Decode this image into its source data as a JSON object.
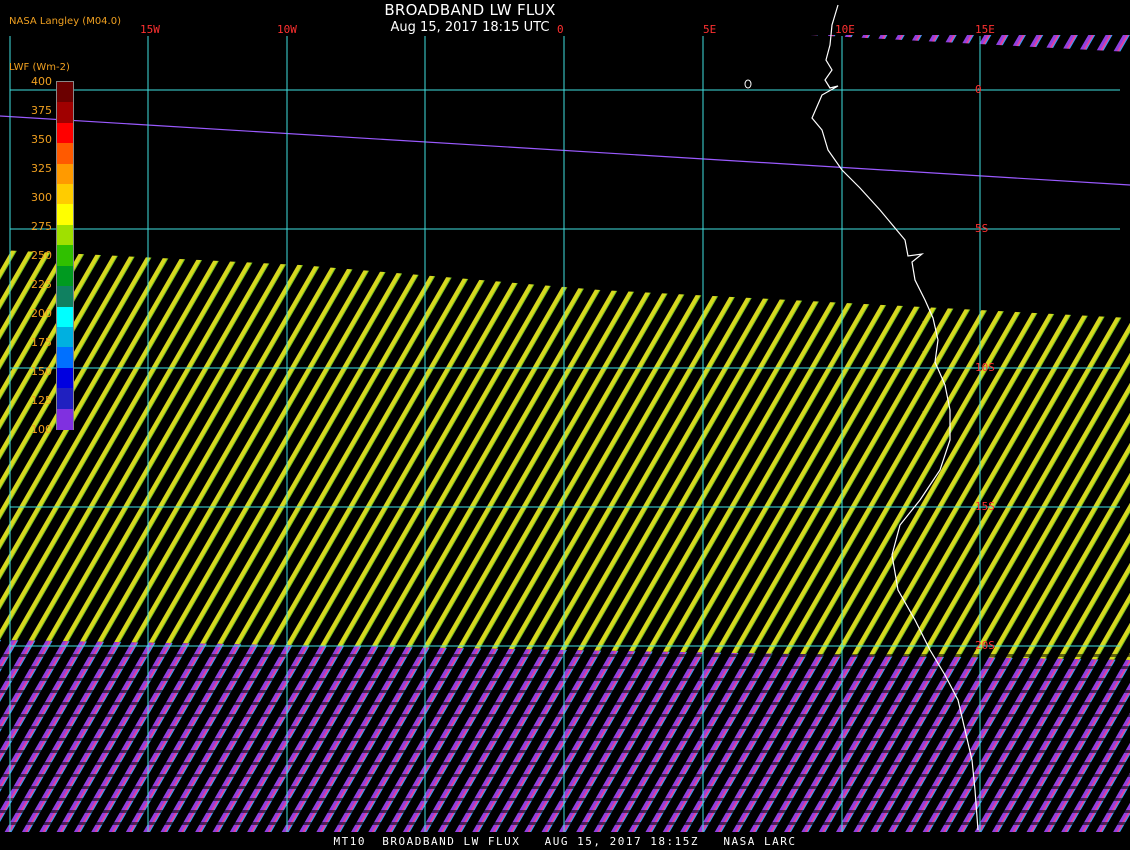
{
  "header": {
    "title": "BROADBAND LW FLUX",
    "datetime": "Aug 15, 2017 18:15 UTC",
    "source": "NASA Langley (M04.0)"
  },
  "colorbar": {
    "label": "LWF (Wm-2)",
    "ticks": [
      "400",
      "375",
      "350",
      "325",
      "300",
      "275",
      "250",
      "225",
      "200",
      "175",
      "150",
      "125",
      "100"
    ],
    "segments": [
      "#6b0000",
      "#a00000",
      "#ff0000",
      "#ff5a00",
      "#ff9a00",
      "#ffcc00",
      "#ffff00",
      "#a0e000",
      "#30c000",
      "#009a20",
      "#108060",
      "#00ffff",
      "#00b0e0",
      "#0070ff",
      "#0000e0",
      "#2020c0",
      "#8030e0"
    ]
  },
  "grid": {
    "lon_labels": [
      "15W",
      "10W",
      "0",
      "5E",
      "10E",
      "15E"
    ],
    "lat_labels": [
      "0",
      "5S",
      "10S",
      "15S",
      "20S"
    ],
    "line_color": "#40e0e0",
    "label_color": "#ff3030"
  },
  "footer": {
    "text": "MT10  BROADBAND LW FLUX   AUG 15, 2017 18:15Z   NASA LARC"
  }
}
